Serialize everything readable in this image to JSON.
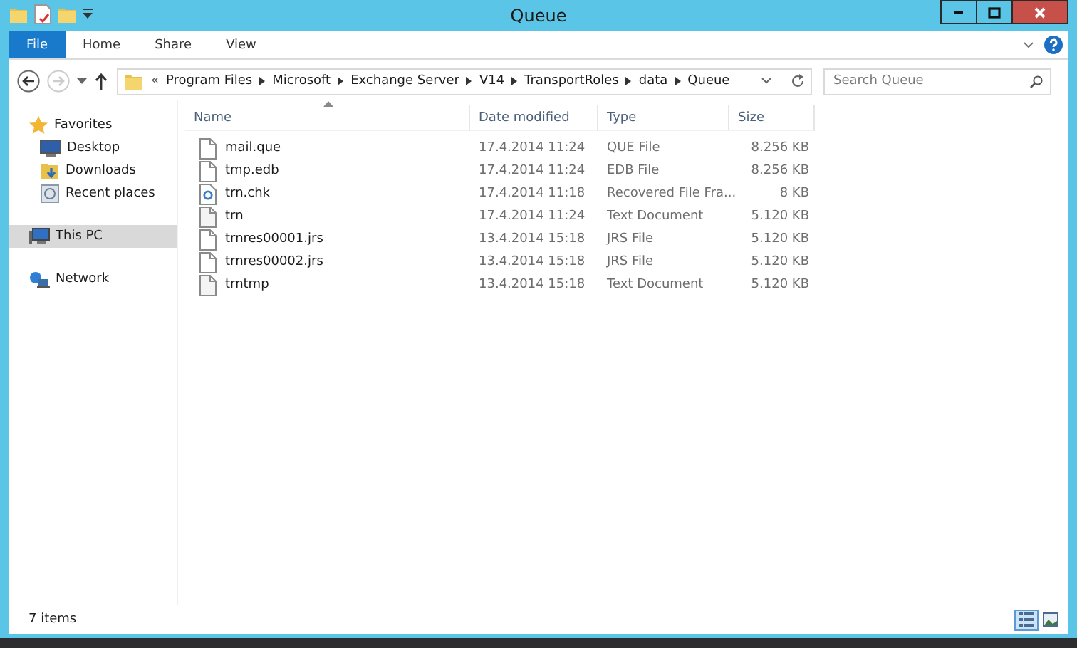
{
  "window": {
    "title": "Queue"
  },
  "ribbon": {
    "tabs": [
      {
        "label": "File",
        "kind": "file"
      },
      {
        "label": "Home",
        "kind": "tab"
      },
      {
        "label": "Share",
        "kind": "tab"
      },
      {
        "label": "View",
        "kind": "tab"
      }
    ]
  },
  "address": {
    "overflow": "«",
    "segments": [
      "Program Files",
      "Microsoft",
      "Exchange Server",
      "V14",
      "TransportRoles",
      "data",
      "Queue"
    ]
  },
  "search": {
    "placeholder": "Search Queue"
  },
  "sidebar": {
    "items": [
      {
        "label": "Favorites",
        "kind": "favorites",
        "selected": false,
        "children": [
          {
            "label": "Desktop",
            "kind": "desktop",
            "selected": false
          },
          {
            "label": "Downloads",
            "kind": "downloads",
            "selected": false
          },
          {
            "label": "Recent places",
            "kind": "recent",
            "selected": false
          }
        ]
      },
      {
        "label": "This PC",
        "kind": "pc",
        "selected": true
      },
      {
        "label": "Network",
        "kind": "network",
        "selected": false
      }
    ]
  },
  "table": {
    "columns": [
      {
        "label": "Name",
        "sorted": true
      },
      {
        "label": "Date modified",
        "sorted": false
      },
      {
        "label": "Type",
        "sorted": false
      },
      {
        "label": "Size",
        "sorted": false
      }
    ],
    "rows": [
      {
        "kind": "file",
        "name": "mail.que",
        "date": "17.4.2014 11:24",
        "type": "QUE File",
        "size": "8.256 KB"
      },
      {
        "kind": "file",
        "name": "tmp.edb",
        "date": "17.4.2014 11:24",
        "type": "EDB File",
        "size": "8.256 KB"
      },
      {
        "kind": "system",
        "name": "trn.chk",
        "date": "17.4.2014 11:18",
        "type": "Recovered File Fra...",
        "size": "8 KB"
      },
      {
        "kind": "text",
        "name": "trn",
        "date": "17.4.2014 11:24",
        "type": "Text Document",
        "size": "5.120 KB"
      },
      {
        "kind": "file",
        "name": "trnres00001.jrs",
        "date": "13.4.2014 15:18",
        "type": "JRS File",
        "size": "5.120 KB"
      },
      {
        "kind": "file",
        "name": "trnres00002.jrs",
        "date": "13.4.2014 15:18",
        "type": "JRS File",
        "size": "5.120 KB"
      },
      {
        "kind": "text",
        "name": "trntmp",
        "date": "13.4.2014 15:18",
        "type": "Text Document",
        "size": "5.120 KB"
      }
    ]
  },
  "status_bar": {
    "text": "7 items",
    "views": [
      {
        "kind": "details",
        "selected": true
      },
      {
        "kind": "large",
        "selected": false
      }
    ]
  }
}
